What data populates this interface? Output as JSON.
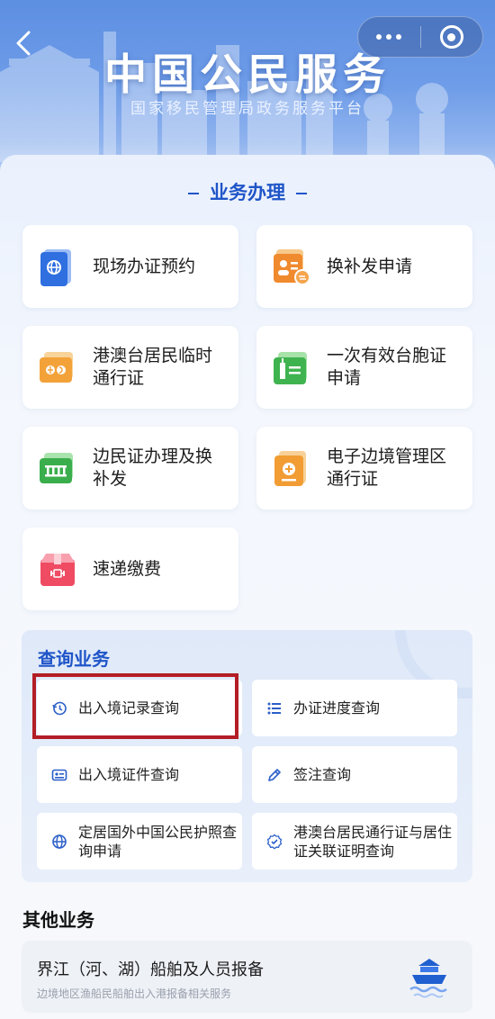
{
  "header": {
    "title": "中国公民服务",
    "subtitle": "国家移民管理局政务服务平台"
  },
  "business": {
    "section_title": "业务办理",
    "items": [
      {
        "label": "现场办证预约",
        "icon": "passport-globe-icon"
      },
      {
        "label": "换补发申请",
        "icon": "id-card-exchange-icon"
      },
      {
        "label": "港澳台居民临时通行证",
        "icon": "travel-permit-icon"
      },
      {
        "label": "一次有效台胞证申请",
        "icon": "taiwan-permit-icon"
      },
      {
        "label": "边民证办理及换补发",
        "icon": "border-resident-card-icon"
      },
      {
        "label": "电子边境管理区通行证",
        "icon": "border-pass-icon"
      },
      {
        "label": "速递缴费",
        "icon": "package-payment-icon"
      }
    ]
  },
  "query": {
    "title": "查询业务",
    "items": [
      {
        "label": "出入境记录查询",
        "icon": "history-clock-icon"
      },
      {
        "label": "办证进度查询",
        "icon": "progress-list-icon"
      },
      {
        "label": "出入境证件查询",
        "icon": "id-document-icon"
      },
      {
        "label": "签注查询",
        "icon": "endorsement-pen-icon"
      },
      {
        "label": "定居国外中国公民护照查询申请",
        "icon": "globe-icon"
      },
      {
        "label": "港澳台居民通行证与居住证关联证明查询",
        "icon": "verified-badge-icon"
      }
    ]
  },
  "other": {
    "title": "其他业务",
    "items": [
      {
        "name": "界江（河、湖）船舶及人员报备",
        "desc": "边境地区渔船民船舶出入港报备相关服务",
        "icon": "ship-icon"
      }
    ]
  },
  "colors": {
    "accent": "#1f55c8",
    "highlight": "#b31d25",
    "header": "#5d8fe2"
  }
}
